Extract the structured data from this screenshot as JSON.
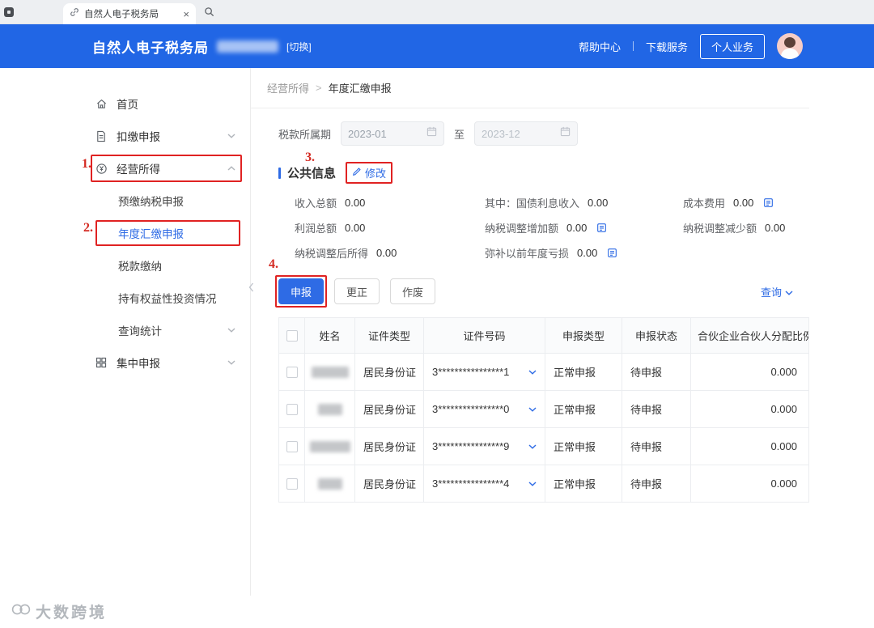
{
  "browser": {
    "tab_title": "自然人电子税务局",
    "close_symbol": "×"
  },
  "header": {
    "title": "自然人电子税务局",
    "switch_label": "[切换]",
    "help_center": "帮助中心",
    "download_service": "下载服务",
    "personal_business": "个人业务"
  },
  "sidebar": {
    "items": [
      {
        "label": "首页"
      },
      {
        "label": "扣缴申报"
      },
      {
        "label": "经营所得"
      },
      {
        "label": "预缴纳税申报"
      },
      {
        "label": "年度汇缴申报"
      },
      {
        "label": "税款缴纳"
      },
      {
        "label": "持有权益性投资情况"
      },
      {
        "label": "查询统计"
      },
      {
        "label": "集中申报"
      }
    ]
  },
  "breadcrumb": {
    "parent": "经营所得",
    "separator": ">",
    "current": "年度汇缴申报"
  },
  "filter": {
    "period_label": "税款所属期",
    "date_from": "2023-01",
    "to_label": "至",
    "date_to": "2023-12"
  },
  "public_info": {
    "title": "公共信息",
    "modify_label": "修改",
    "fields": [
      {
        "label": "收入总额",
        "value": "0.00"
      },
      {
        "label": "其中：国债利息收入",
        "value": "0.00"
      },
      {
        "label": "成本费用",
        "value": "0.00"
      },
      {
        "label": "利润总额",
        "value": "0.00"
      },
      {
        "label": "纳税调整增加额",
        "value": "0.00"
      },
      {
        "label": "纳税调整减少额",
        "value": "0.00"
      },
      {
        "label": "纳税调整后所得",
        "value": "0.00"
      },
      {
        "label": "弥补以前年度亏损",
        "value": "0.00"
      }
    ]
  },
  "toolbar": {
    "declare": "申报",
    "correct": "更正",
    "void": "作废",
    "query": "查询"
  },
  "table": {
    "columns": [
      "姓名",
      "证件类型",
      "证件号码",
      "申报类型",
      "申报状态",
      "合伙企业合伙人分配比例"
    ],
    "rows": [
      {
        "cert_type": "居民身份证",
        "cert_no": "3****************1",
        "declare_type": "正常申报",
        "status": "待申报",
        "ratio": "0.000"
      },
      {
        "cert_type": "居民身份证",
        "cert_no": "3****************0",
        "declare_type": "正常申报",
        "status": "待申报",
        "ratio": "0.000"
      },
      {
        "cert_type": "居民身份证",
        "cert_no": "3****************9",
        "declare_type": "正常申报",
        "status": "待申报",
        "ratio": "0.000"
      },
      {
        "cert_type": "居民身份证",
        "cert_no": "3****************4",
        "declare_type": "正常申报",
        "status": "待申报",
        "ratio": "0.000"
      }
    ]
  },
  "annotations": {
    "step1": "1.",
    "step2": "2.",
    "step3": "3.",
    "step4": "4."
  },
  "watermark": {
    "text": "大数跨境"
  },
  "colors": {
    "header_blue": "#2166e5",
    "accent_blue": "#2e6be5",
    "annotation_red": "#e02222"
  }
}
